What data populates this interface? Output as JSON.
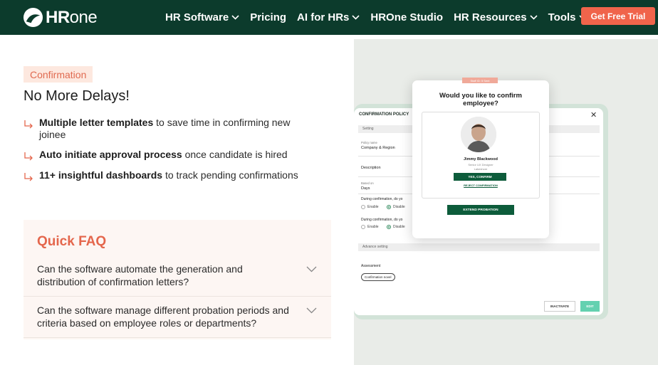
{
  "brand": {
    "logo_bold": "HR",
    "logo_light": "one"
  },
  "nav": {
    "items": [
      {
        "label": "HR Software",
        "dropdown": true
      },
      {
        "label": "Pricing",
        "dropdown": false
      },
      {
        "label": "AI for HRs",
        "dropdown": true
      },
      {
        "label": "HROne Studio",
        "dropdown": false
      },
      {
        "label": "HR Resources",
        "dropdown": true
      },
      {
        "label": "Tools",
        "dropdown": true
      }
    ],
    "cta": "Get Free Trial"
  },
  "hero": {
    "tag": "Confirmation",
    "headline": "No More Delays!",
    "features": [
      {
        "bold": "Multiple letter templates",
        "rest": " to save time in confirming new joinee"
      },
      {
        "bold": "Auto initiate approval process",
        "rest": " once candidate is hired"
      },
      {
        "bold": "11+ insightful dashboards",
        "rest": " to track pending confirmations"
      }
    ]
  },
  "faq": {
    "title": "Quick FAQ",
    "items": [
      {
        "question": "Can the software automate the generation and distribution of confirmation letters?"
      },
      {
        "question": "Can the software manage different probation periods and criteria based on employee roles or departments?"
      }
    ]
  },
  "illustration": {
    "panel_title": "CONFIRMATION POLICY",
    "close_glyph": "✕",
    "setting_label": "Setting",
    "policy_name_label": "Policy name",
    "policy_name_value": "Company & Region",
    "description_label": "Description",
    "based_on_label": "Based on",
    "based_on_value": "Days",
    "during_label_1": "During confirmation, do yo",
    "during_label_2": "During confirmation, do yo",
    "enable": "Enable",
    "disable": "Disable",
    "advance_setting": "Advance setting",
    "assessment_label": "Assessment",
    "assessment_pill": "Confirmation novel",
    "inactivate": "INACTIVATE",
    "edit": "EDIT",
    "modal": {
      "badge": "Staff ID: 5 Sent",
      "title": "Would you like to confirm employee?",
      "name": "Jimmy Blackwood",
      "role": "Senior UX Designer",
      "role2": "Lakeshore",
      "confirm": "YES, CONFIRM",
      "reject": "REJECT CONFIRMATION",
      "extend": "EXTEND PROBATION"
    }
  },
  "colors": {
    "nav_bg": "#0c3b2c",
    "accent": "#f0644b",
    "faq_title": "#e4664c",
    "primary_green": "#0d5c3b"
  }
}
